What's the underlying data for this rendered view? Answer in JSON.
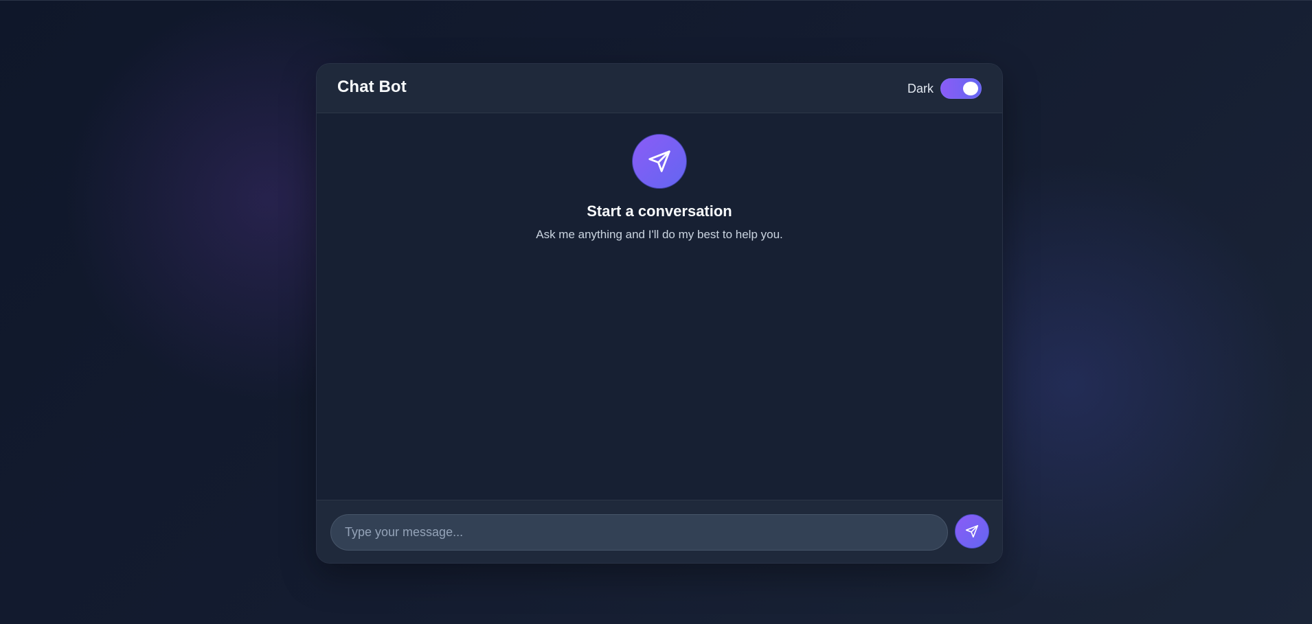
{
  "app": {
    "title": "Chat Bot"
  },
  "header": {
    "theme_label": "Dark",
    "theme_toggle_on": true
  },
  "empty_state": {
    "icon": "send-icon",
    "title": "Start a conversation",
    "subtitle": "Ask me anything and I'll do my best to help you."
  },
  "composer": {
    "value": "",
    "placeholder": "Type your message...",
    "send_icon": "send-icon"
  },
  "colors": {
    "accent_start": "#8b5cf6",
    "accent_end": "#6366f1",
    "background": "#0f172a",
    "panel": "#172033",
    "header": "#1f293b",
    "input": "#334155"
  }
}
